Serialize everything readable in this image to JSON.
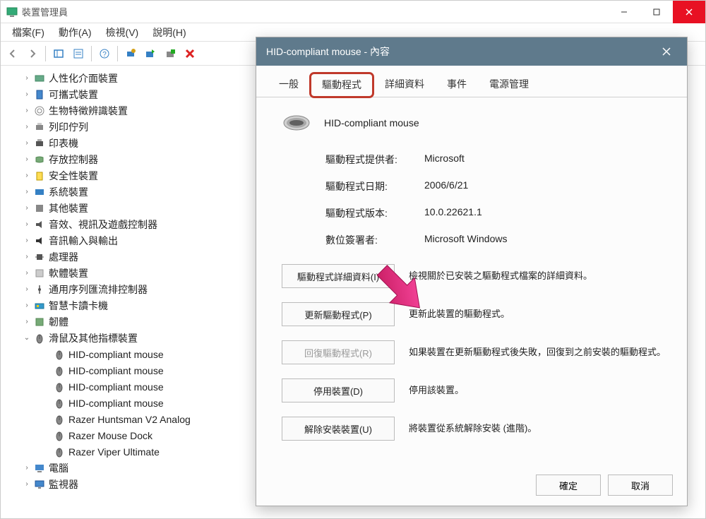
{
  "app": {
    "title": "裝置管理員"
  },
  "menu": {
    "file": "檔案(F)",
    "action": "動作(A)",
    "view": "檢視(V)",
    "help": "說明(H)"
  },
  "tree": {
    "items": [
      {
        "label": "人性化介面裝置",
        "icon": "hid"
      },
      {
        "label": "可攜式裝置",
        "icon": "portable"
      },
      {
        "label": "生物特徵辨識裝置",
        "icon": "biometric"
      },
      {
        "label": "列印佇列",
        "icon": "printq"
      },
      {
        "label": "印表機",
        "icon": "printer"
      },
      {
        "label": "存放控制器",
        "icon": "storage"
      },
      {
        "label": "安全性裝置",
        "icon": "security"
      },
      {
        "label": "系統裝置",
        "icon": "system"
      },
      {
        "label": "其他裝置",
        "icon": "other"
      },
      {
        "label": "音效、視訊及遊戲控制器",
        "icon": "audio"
      },
      {
        "label": "音訊輸入與輸出",
        "icon": "audioio"
      },
      {
        "label": "處理器",
        "icon": "cpu"
      },
      {
        "label": "軟體裝置",
        "icon": "software"
      },
      {
        "label": "通用序列匯流排控制器",
        "icon": "usb"
      },
      {
        "label": "智慧卡讀卡機",
        "icon": "smartcard"
      },
      {
        "label": "韌體",
        "icon": "firmware"
      }
    ],
    "mouse_category": "滑鼠及其他指標裝置",
    "mouse_children": [
      "HID-compliant mouse",
      "HID-compliant mouse",
      "HID-compliant mouse",
      "HID-compliant mouse",
      "Razer Huntsman V2 Analog",
      "Razer Mouse Dock",
      "Razer Viper Ultimate"
    ],
    "after": [
      {
        "label": "電腦",
        "icon": "computer"
      },
      {
        "label": "監視器",
        "icon": "monitor"
      }
    ]
  },
  "dialog": {
    "title": "HID-compliant mouse - 內容",
    "tabs": {
      "general": "一般",
      "driver": "驅動程式",
      "details": "詳細資料",
      "events": "事件",
      "power": "電源管理"
    },
    "device_name": "HID-compliant mouse",
    "info": {
      "provider_label": "驅動程式提供者:",
      "provider_value": "Microsoft",
      "date_label": "驅動程式日期:",
      "date_value": "2006/6/21",
      "version_label": "驅動程式版本:",
      "version_value": "10.0.22621.1",
      "signer_label": "數位簽署者:",
      "signer_value": "Microsoft Windows"
    },
    "actions": {
      "details_btn": "驅動程式詳細資料(I)",
      "details_desc": "檢視關於已安裝之驅動程式檔案的詳細資料。",
      "update_btn": "更新驅動程式(P)",
      "update_desc": "更新此裝置的驅動程式。",
      "rollback_btn": "回復驅動程式(R)",
      "rollback_desc": "如果裝置在更新驅動程式後失敗，回復到之前安裝的驅動程式。",
      "disable_btn": "停用裝置(D)",
      "disable_desc": "停用該裝置。",
      "uninstall_btn": "解除安裝裝置(U)",
      "uninstall_desc": "將裝置從系統解除安裝 (進階)。"
    },
    "footer": {
      "ok": "確定",
      "cancel": "取消"
    }
  }
}
